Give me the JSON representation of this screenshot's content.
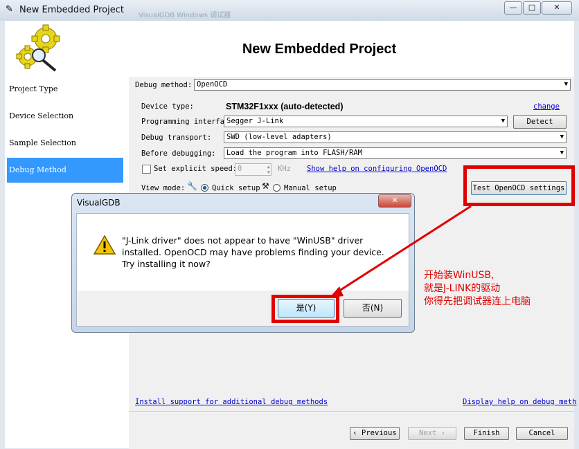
{
  "window": {
    "title": "New Embedded Project",
    "bg_title": "VisualGDB Windows 调试器",
    "controls": {
      "minimize": "—",
      "maximize": "□",
      "close": "✕"
    }
  },
  "header": {
    "title": "New Embedded Project"
  },
  "nav": {
    "items": [
      {
        "label": "Project Type",
        "active": false
      },
      {
        "label": "Device Selection",
        "active": false
      },
      {
        "label": "Sample Selection",
        "active": false
      },
      {
        "label": "Debug Method",
        "active": true
      }
    ]
  },
  "form": {
    "debug_method_label": "Debug method:",
    "debug_method_value": "OpenOCD",
    "device_type_label": "Device type:",
    "device_type_value": "STM32F1xxx (auto-detected)",
    "change_link": "change",
    "prog_interface_label": "Programming interfac",
    "prog_interface_value": "Segger J-Link",
    "detect_button": "Detect",
    "debug_transport_label": "Debug transport:",
    "debug_transport_value": "SWD (low-level adapters)",
    "before_debugging_label": "Before debugging:",
    "before_debugging_value": "Load the program into FLASH/RAM",
    "explicit_speed_label": "Set explicit speed:",
    "explicit_speed_value": "0",
    "speed_unit": "KHz",
    "help_link": "Show help on configuring OpenOCD",
    "view_mode_label": "View mode:",
    "quick_setup_label": "Quick setup",
    "manual_setup_label": "Manual setup",
    "test_button": "Test OpenOCD settings",
    "install_link": "Install support for additional debug methods",
    "display_help_link": "Display help on debug meth"
  },
  "footer": {
    "previous": "Previous",
    "next": "Next",
    "finish": "Finish",
    "cancel": "Cancel"
  },
  "dialog": {
    "title": "VisualGDB",
    "message": "\"J-Link driver\" does not appear to have \"WinUSB\" driver installed. OpenOCD may have problems finding your device. Try installing it now?",
    "yes_button": "是(Y)",
    "no_button": "否(N)"
  },
  "annotation": {
    "line1": "开始装WinUSB,",
    "line2": "就是J-LINK的驱动",
    "line3": "你得先把调试器连上电脑"
  },
  "colors": {
    "accent": "#3399ff",
    "highlight": "#e00000",
    "link": "#0000cc"
  }
}
